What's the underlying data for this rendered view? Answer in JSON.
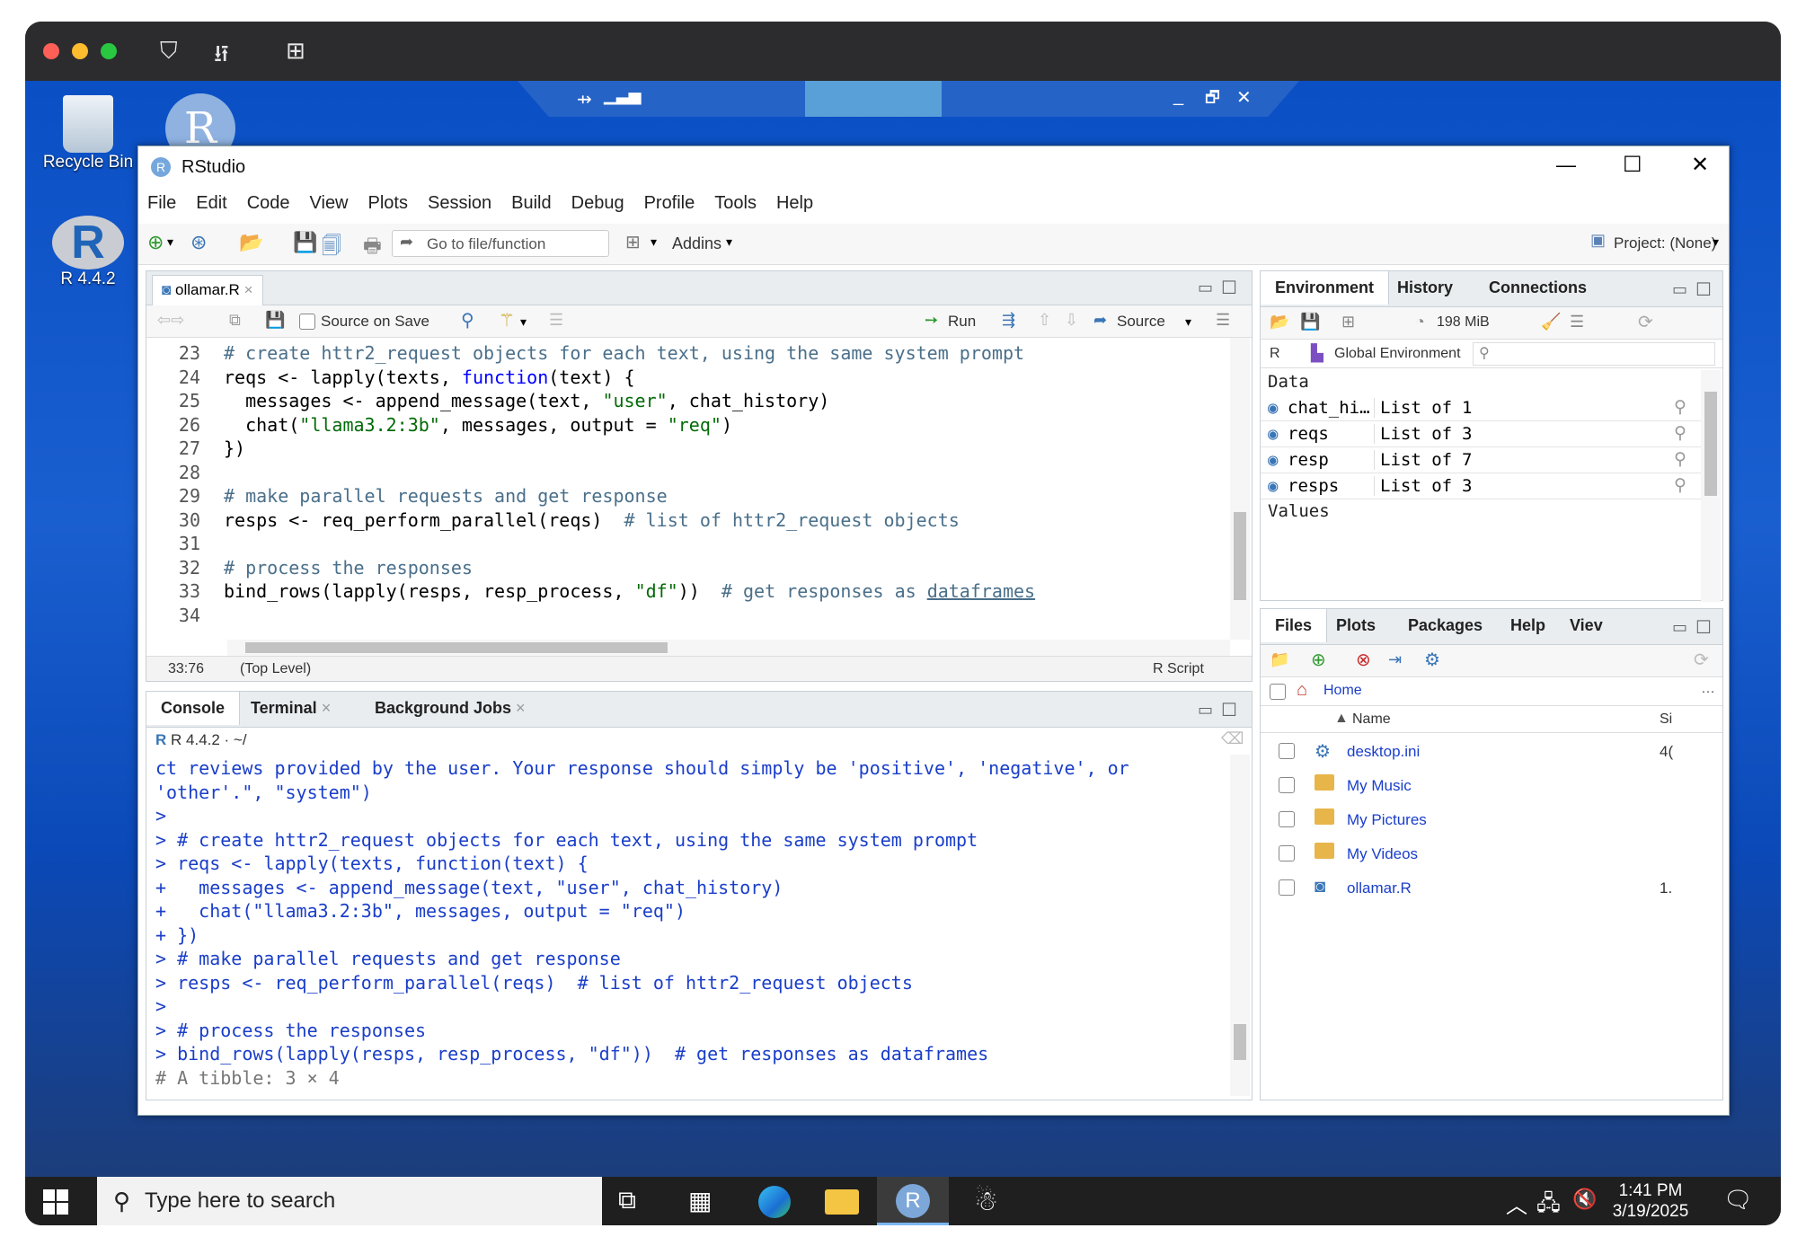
{
  "desktop": {
    "icons": [
      {
        "label": "Recycle Bin"
      },
      {
        "label": "R 4.4.2"
      }
    ],
    "rdp": {
      "min": "_",
      "restore": "🗗",
      "close": "✕"
    }
  },
  "window": {
    "title": "RStudio",
    "controls": {
      "min": "—",
      "max": "☐",
      "close": "✕"
    }
  },
  "menu": [
    "File",
    "Edit",
    "Code",
    "View",
    "Plots",
    "Session",
    "Build",
    "Debug",
    "Profile",
    "Tools",
    "Help"
  ],
  "toolbar": {
    "goto_placeholder": "Go to file/function",
    "addins": "Addins",
    "project": "Project: (None)"
  },
  "editor": {
    "tab": "ollamar.R",
    "source_on_save": "Source on Save",
    "run": "Run",
    "source": "Source",
    "status_pos": "33:76",
    "status_level": "(Top Level)",
    "status_type": "R Script",
    "lines": [
      {
        "n": "23",
        "html": "<span class='cmt'># create httr2_request objects for each text, using the same system prompt</span>"
      },
      {
        "n": "24",
        "html": "reqs &lt;- lapply(texts, <span class='kw'>function</span>(text) {"
      },
      {
        "n": "25",
        "html": "  messages &lt;- append_message(text, <span class='str'>\"user\"</span>, chat_history)"
      },
      {
        "n": "26",
        "html": "  chat(<span class='str'>\"llama3.2:3b\"</span>, messages, output = <span class='str'>\"req\"</span>)"
      },
      {
        "n": "27",
        "html": "})"
      },
      {
        "n": "28",
        "html": ""
      },
      {
        "n": "29",
        "html": "<span class='cmt'># make parallel requests and get response</span>"
      },
      {
        "n": "30",
        "html": "resps &lt;- req_perform_parallel(reqs)  <span class='cmt'># list of httr2_request objects</span>"
      },
      {
        "n": "31",
        "html": ""
      },
      {
        "n": "32",
        "html": "<span class='cmt'># process the responses</span>"
      },
      {
        "n": "33",
        "html": "bind_rows(lapply(resps, resp_process, <span class='str'>\"df\"</span>))  <span class='cmt'># get responses as <u>dataframes</u></span>"
      },
      {
        "n": "34",
        "html": ""
      }
    ]
  },
  "console": {
    "tabs": [
      "Console",
      "Terminal",
      "Background Jobs"
    ],
    "r_version": "R 4.4.2 · ~/",
    "lines": [
      "ct reviews provided by the user. Your response should simply be 'positive', 'negative', or",
      "'other'.\", \"system\")",
      ">",
      "> # create httr2_request objects for each text, using the same system prompt",
      "> reqs <- lapply(texts, function(text) {",
      "+   messages <- append_message(text, \"user\", chat_history)",
      "+   chat(\"llama3.2:3b\", messages, output = \"req\")",
      "+ })",
      "> # make parallel requests and get response",
      "> resps <- req_perform_parallel(reqs)  # list of httr2_request objects",
      ">",
      "> # process the responses",
      "> bind_rows(lapply(resps, resp_process, \"df\"))  # get responses as dataframes",
      "# A tibble: 3 × 4"
    ]
  },
  "environment": {
    "tabs": [
      "Environment",
      "History",
      "Connections"
    ],
    "memory": "198 MiB",
    "lang": "R",
    "scope": "Global Environment",
    "section_data": "Data",
    "section_values": "Values",
    "rows": [
      {
        "name": "chat_hi…",
        "type": "List of",
        "count": "1"
      },
      {
        "name": "reqs",
        "type": "List of",
        "count": "3"
      },
      {
        "name": "resp",
        "type": "List of",
        "count": "7"
      },
      {
        "name": "resps",
        "type": "List of",
        "count": "3"
      }
    ]
  },
  "files": {
    "tabs": [
      "Files",
      "Plots",
      "Packages",
      "Help",
      "Viev"
    ],
    "home": "Home",
    "col_name": "Name",
    "col_size": "Si",
    "items": [
      {
        "name": "desktop.ini",
        "size": "4(",
        "kind": "file"
      },
      {
        "name": "My Music",
        "size": "",
        "kind": "folder"
      },
      {
        "name": "My Pictures",
        "size": "",
        "kind": "folder"
      },
      {
        "name": "My Videos",
        "size": "",
        "kind": "folder"
      },
      {
        "name": "ollamar.R",
        "size": "1.",
        "kind": "rfile"
      }
    ]
  },
  "taskbar": {
    "search_placeholder": "Type here to search",
    "time": "1:41 PM",
    "date": "3/19/2025"
  }
}
